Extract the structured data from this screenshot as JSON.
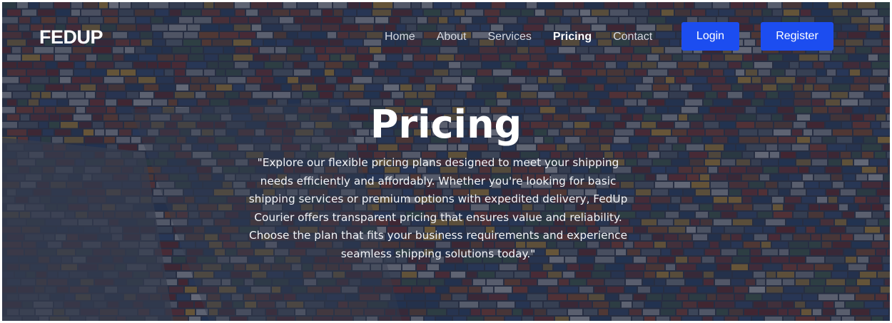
{
  "brand": {
    "logo_text": "FEDUP"
  },
  "nav": {
    "items": [
      {
        "label": "Home",
        "active": false
      },
      {
        "label": "About",
        "active": false
      },
      {
        "label": "Services",
        "active": false
      },
      {
        "label": "Pricing",
        "active": true
      },
      {
        "label": "Contact",
        "active": false
      }
    ],
    "login_label": "Login",
    "register_label": "Register"
  },
  "hero": {
    "title": "Pricing",
    "description": "\"Explore our flexible pricing plans designed to meet your shipping needs efficiently and affordably. Whether you're looking for basic shipping services or premium options with expedited delivery, FedUp Courier offers transparent pricing that ensures value and reliability. Choose the plan that fits your business requirements and experience seamless shipping solutions today.\""
  },
  "colors": {
    "accent": "#1c4df0",
    "overlay": "#181e32",
    "text": "#ffffff"
  }
}
